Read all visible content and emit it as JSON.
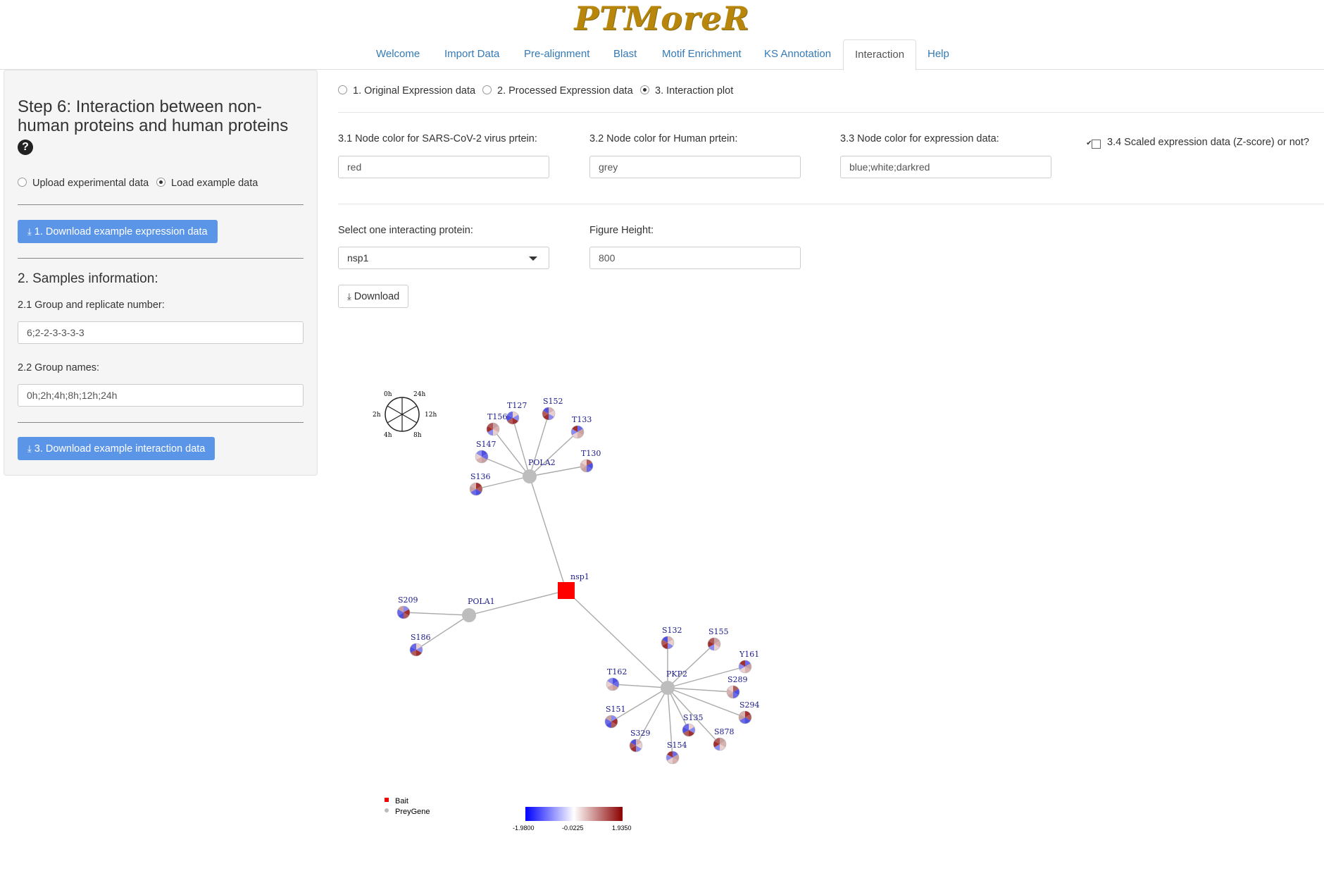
{
  "app": {
    "logo": "PTMoreR"
  },
  "nav": {
    "tabs": [
      {
        "label": "Welcome"
      },
      {
        "label": "Import Data"
      },
      {
        "label": "Pre-alignment"
      },
      {
        "label": "Blast"
      },
      {
        "label": "Motif Enrichment"
      },
      {
        "label": "KS Annotation"
      },
      {
        "label": "Interaction",
        "active": true
      },
      {
        "label": "Help"
      }
    ]
  },
  "sidebar": {
    "title": "Step 6: Interaction between non-human proteins and human proteins",
    "help_icon": "question-circle-icon",
    "data_source": {
      "options": [
        "Upload experimental data",
        "Load example data"
      ],
      "selected": "Load example data"
    },
    "download_expression_label": "1. Download example expression data",
    "samples_heading": "2. Samples information:",
    "group_replicate_label": "2.1 Group and replicate number:",
    "group_replicate_value": "6;2-2-3-3-3-3",
    "group_names_label": "2.2 Group names:",
    "group_names_value": "0h;2h;4h;8h;12h;24h",
    "download_interaction_label": "3. Download example interaction data"
  },
  "main": {
    "view_options": [
      "1. Original Expression data",
      "2. Processed Expression data",
      "3. Interaction plot"
    ],
    "view_selected": "3. Interaction plot",
    "virus_color_label": "3.1 Node color for SARS-CoV-2 virus prtein:",
    "virus_color_value": "red",
    "human_color_label": "3.2 Node color for Human prtein:",
    "human_color_value": "grey",
    "expr_color_label": "3.3 Node color for expression data:",
    "expr_color_value": "blue;white;darkred",
    "scaled_label": "3.4 Scaled expression data (Z-score) or not?",
    "scaled_checked": true,
    "select_protein_label": "Select one interacting protein:",
    "select_protein_value": "nsp1",
    "figure_height_label": "Figure Height:",
    "figure_height_value": "800",
    "download_label": "Download"
  },
  "plot": {
    "time_key": [
      "0h",
      "24h",
      "2h",
      "12h",
      "4h",
      "8h"
    ],
    "bait": "nsp1",
    "prey_genes": [
      "POLA2",
      "POLA1",
      "PKP2"
    ],
    "sites": {
      "POLA2": [
        "T127",
        "S152",
        "T156",
        "T133",
        "S147",
        "T130",
        "S136"
      ],
      "POLA1": [
        "S209",
        "S186"
      ],
      "PKP2": [
        "S132",
        "S155",
        "Y161",
        "T162",
        "S289",
        "S294",
        "S151",
        "S135",
        "S329",
        "S878",
        "S154"
      ]
    },
    "legend": {
      "bait": "Bait",
      "prey": "PreyGene"
    },
    "colorbar": {
      "colors": [
        "#0000ff",
        "#ffffff",
        "#8b0000"
      ],
      "ticks": [
        "-1.9800",
        "-0.0225",
        "1.9350"
      ]
    }
  }
}
